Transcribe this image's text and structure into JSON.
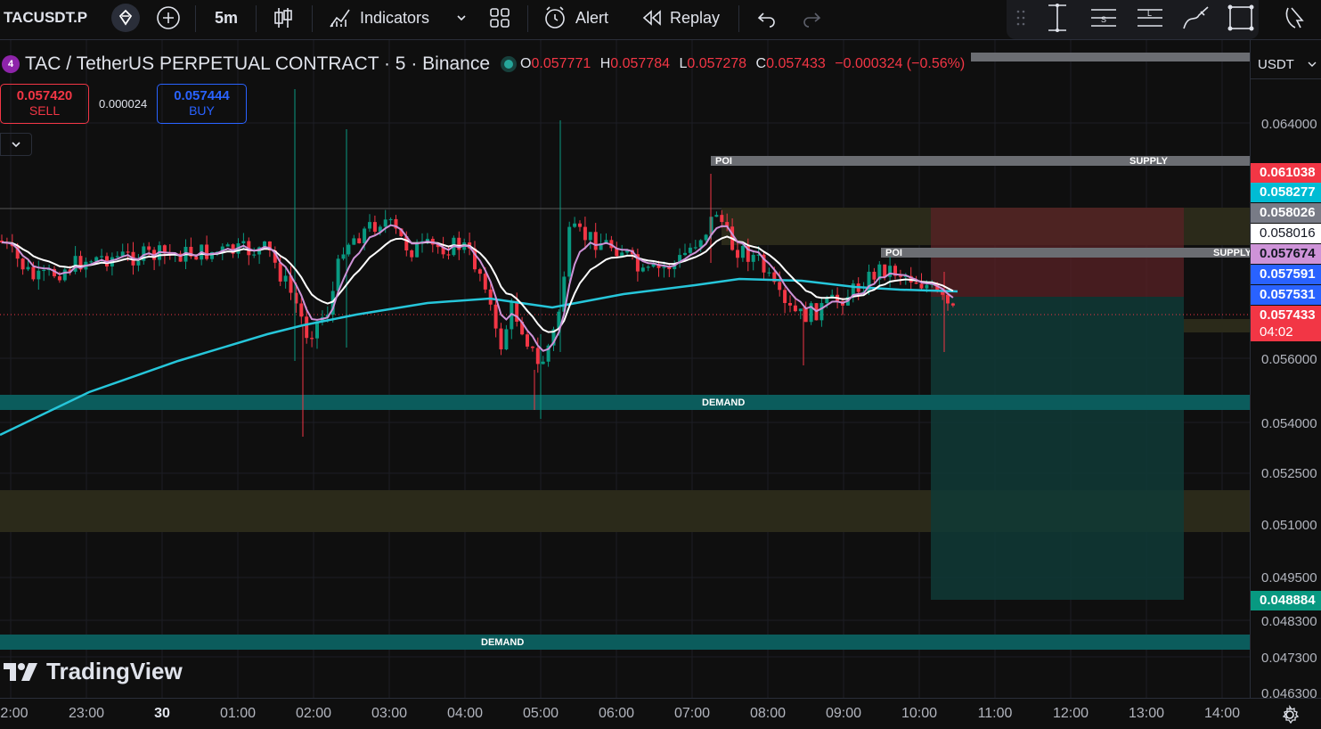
{
  "toolbar": {
    "symbol": "TACUSDT.P",
    "interval": "5m",
    "indicators_label": "Indicators",
    "alert_label": "Alert",
    "replay_label": "Replay"
  },
  "legend": {
    "title": "TAC / TetherUS PERPETUAL CONTRACT · 5 · Binance",
    "o_label": "O",
    "o_value": "0.057771",
    "h_label": "H",
    "h_value": "0.057784",
    "l_label": "L",
    "l_value": "0.057278",
    "c_label": "C",
    "c_value": "0.057433",
    "change": "−0.000324 (−0.56%)"
  },
  "trade": {
    "sell_price": "0.057420",
    "sell_label": "SELL",
    "spread": "0.000024",
    "buy_price": "0.057444",
    "buy_label": "BUY"
  },
  "currency": "USDT",
  "price_axis": {
    "labels": [
      "0.064000",
      "0.056000",
      "0.054000",
      "0.052500",
      "0.051000",
      "0.049500",
      "0.048300",
      "0.047300",
      "0.046300"
    ],
    "tags": [
      {
        "value": "0.061038",
        "color": "#f23645"
      },
      {
        "value": "0.058277",
        "color": "#00bcd4"
      },
      {
        "value": "0.058026",
        "color": "#787b86"
      },
      {
        "value": "0.058016",
        "color": "#ffffff"
      },
      {
        "value": "0.057674",
        "color": "#ce93d8"
      },
      {
        "value": "0.057591",
        "color": "#2962ff"
      },
      {
        "value": "0.057531",
        "color": "#2962ff"
      },
      {
        "value": "0.057433",
        "color": "#f23645"
      },
      {
        "value": "0.048884",
        "color": "#089981"
      }
    ],
    "countdown": "04:02"
  },
  "time_axis": [
    "2:00",
    "23:00",
    "30",
    "01:00",
    "02:00",
    "03:00",
    "04:00",
    "05:00",
    "06:00",
    "07:00",
    "08:00",
    "09:00",
    "10:00",
    "11:00",
    "12:00",
    "13:00",
    "14:00"
  ],
  "zones": {
    "poi_label": "POI",
    "supply_label": "SUPPLY",
    "supply_partial": "SUPPLY",
    "demand_label": "DEMAND"
  },
  "watermark": "TradingView",
  "colors": {
    "up": "#089981",
    "down": "#f23645",
    "ema_white": "#ffffff",
    "ema_purple": "#ce93d8",
    "ema_cyan": "#26c6da",
    "demand_zone": "#0b5c5c",
    "supply_zone": "#2a2a1a"
  }
}
